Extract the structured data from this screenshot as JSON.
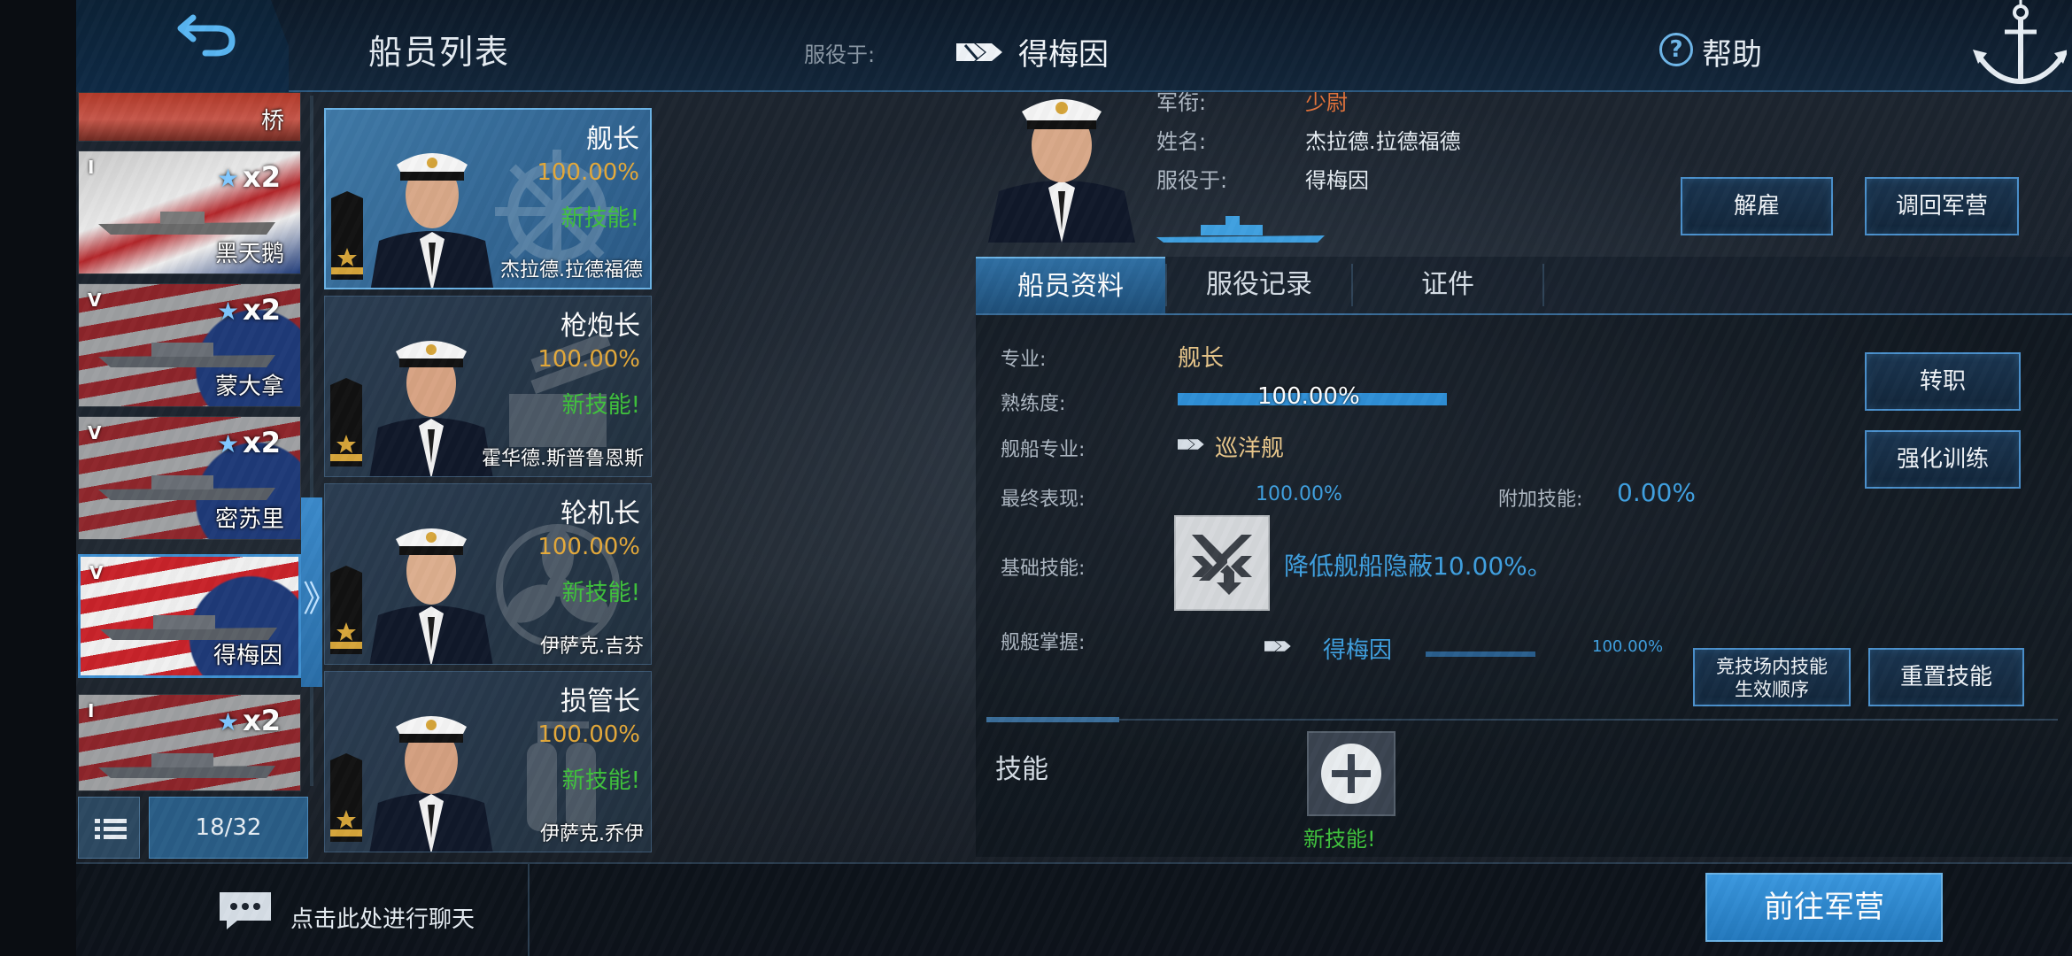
{
  "header": {
    "title": "船员列表",
    "serving_label": "服役于:",
    "serving_ship": "得梅因",
    "help_label": "帮助"
  },
  "ship_list": [
    {
      "name": "桥",
      "tier": "",
      "boost": ""
    },
    {
      "name": "黑天鹅",
      "tier": "I",
      "boost": "x2"
    },
    {
      "name": "蒙大拿",
      "tier": "V",
      "boost": "x2"
    },
    {
      "name": "密苏里",
      "tier": "V",
      "boost": "x2"
    },
    {
      "name": "得梅因",
      "tier": "V",
      "boost": ""
    },
    {
      "name": "",
      "tier": "I",
      "boost": "x2"
    }
  ],
  "crew_count": "18/32",
  "crew_cards": [
    {
      "role": "舰长",
      "percent": "100.00%",
      "new_skill": "新技能!",
      "name": "杰拉德.拉德福德"
    },
    {
      "role": "枪炮长",
      "percent": "100.00%",
      "new_skill": "新技能!",
      "name": "霍华德.斯普鲁恩斯"
    },
    {
      "role": "轮机长",
      "percent": "100.00%",
      "new_skill": "新技能!",
      "name": "伊萨克.吉芬"
    },
    {
      "role": "损管长",
      "percent": "100.00%",
      "new_skill": "新技能!",
      "name": "伊萨克.乔伊"
    }
  ],
  "detail": {
    "rank_label": "军衔:",
    "rank_value": "少尉",
    "name_label": "姓名:",
    "name_value": "杰拉德.拉德福德",
    "serve_label": "服役于:",
    "serve_value": "得梅因",
    "dismiss_button": "解雇",
    "recall_button": "调回军营"
  },
  "tabs": [
    "船员资料",
    "服役记录",
    "证件"
  ],
  "profile": {
    "specialty_label": "专业:",
    "specialty_value": "舰长",
    "proficiency_label": "熟练度:",
    "proficiency_value": "100.00%",
    "proficiency_fraction": 1.0,
    "ship_spec_label": "舰船专业:",
    "ship_spec_value": "巡洋舰",
    "final_label": "最终表现:",
    "final_value": "100.00%",
    "extra_label": "附加技能:",
    "extra_value": "0.00%",
    "base_skill_label": "基础技能:",
    "base_skill_desc": "降低舰船隐蔽10.00%。",
    "mastery_label": "舰艇掌握:",
    "mastery_ship": "得梅因",
    "mastery_value": "100.00%",
    "transfer_button": "转职",
    "train_button": "强化训练",
    "arena_button_line1": "竞技场内技能",
    "arena_button_line2": "生效顺序",
    "reset_button": "重置技能",
    "skills_title": "技能",
    "new_skill_label": "新技能!"
  },
  "bottom": {
    "chat_text": "点击此处进行聊天",
    "goto_button": "前往军营"
  },
  "colors": {
    "accent_blue": "#3fa0e0",
    "new_skill_green": "#3fc23c",
    "percent_gold": "#e4a93a",
    "rank_orange": "#e2723a"
  },
  "icons": [
    "back-arrow-icon",
    "ship-class-icon",
    "help-icon",
    "anchor-icon",
    "rank-insignia-icon",
    "star-icon",
    "list-icon",
    "chat-icon",
    "plus-icon",
    "concealment-skill-icon"
  ]
}
